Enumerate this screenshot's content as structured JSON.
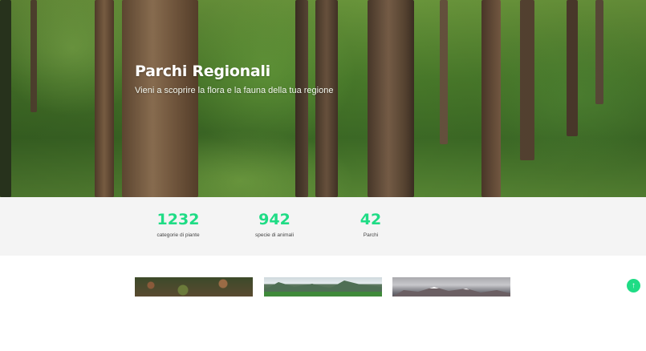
{
  "hero": {
    "title": "Parchi Regionali",
    "subtitle": "Vieni a scoprire la flora e la fauna della tua regione"
  },
  "stats": [
    {
      "number": "1232",
      "label": "categorie di piante"
    },
    {
      "number": "942",
      "label": "specie di animali"
    },
    {
      "number": "42",
      "label": "Parchi"
    }
  ],
  "cards": [
    {
      "image": "forest-floor-photo"
    },
    {
      "image": "mountain-valley-photo"
    },
    {
      "image": "snowy-mountains-photo"
    }
  ],
  "scroll_top": {
    "icon": "arrow-up-icon",
    "glyph": "↑"
  },
  "colors": {
    "accent": "#1fdc85",
    "stats_bg": "#f4f4f4"
  }
}
